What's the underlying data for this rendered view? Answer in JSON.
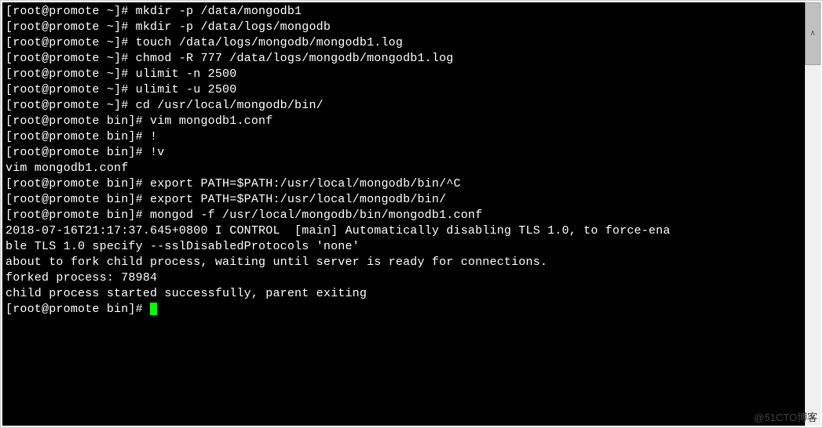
{
  "terminal": {
    "lines": [
      {
        "prompt": "[root@promote ~]# ",
        "cmd": "mkdir -p /data/mongodb1"
      },
      {
        "prompt": "[root@promote ~]# ",
        "cmd": "mkdir -p /data/logs/mongodb"
      },
      {
        "prompt": "[root@promote ~]# ",
        "cmd": "touch /data/logs/mongodb/mongodb1.log"
      },
      {
        "prompt": "[root@promote ~]# ",
        "cmd": "chmod -R 777 /data/logs/mongodb/mongodb1.log"
      },
      {
        "prompt": "[root@promote ~]# ",
        "cmd": "ulimit -n 2500"
      },
      {
        "prompt": "[root@promote ~]# ",
        "cmd": "ulimit -u 2500"
      },
      {
        "prompt": "[root@promote ~]# ",
        "cmd": "cd /usr/local/mongodb/bin/"
      },
      {
        "prompt": "[root@promote bin]# ",
        "cmd": "vim mongodb1.conf"
      },
      {
        "prompt": "[root@promote bin]# ",
        "cmd": "!"
      },
      {
        "prompt": "[root@promote bin]# ",
        "cmd": "!v"
      },
      {
        "prompt": "",
        "cmd": "vim mongodb1.conf"
      },
      {
        "prompt": "[root@promote bin]# ",
        "cmd": "export PATH=$PATH:/usr/local/mongodb/bin/^C"
      },
      {
        "prompt": "[root@promote bin]# ",
        "cmd": "export PATH=$PATH:/usr/local/mongodb/bin/"
      },
      {
        "prompt": "[root@promote bin]# ",
        "cmd": "mongod -f /usr/local/mongodb/bin/mongodb1.conf"
      },
      {
        "prompt": "",
        "cmd": "2018-07-16T21:17:37.645+0800 I CONTROL  [main] Automatically disabling TLS 1.0, to force-ena"
      },
      {
        "prompt": "",
        "cmd": "ble TLS 1.0 specify --sslDisabledProtocols 'none'"
      },
      {
        "prompt": "",
        "cmd": "about to fork child process, waiting until server is ready for connections."
      },
      {
        "prompt": "",
        "cmd": "forked process: 78984"
      },
      {
        "prompt": "",
        "cmd": "child process started successfully, parent exiting"
      },
      {
        "prompt": "[root@promote bin]# ",
        "cmd": "",
        "cursor": true
      }
    ]
  },
  "watermark": "@51CTO博客"
}
